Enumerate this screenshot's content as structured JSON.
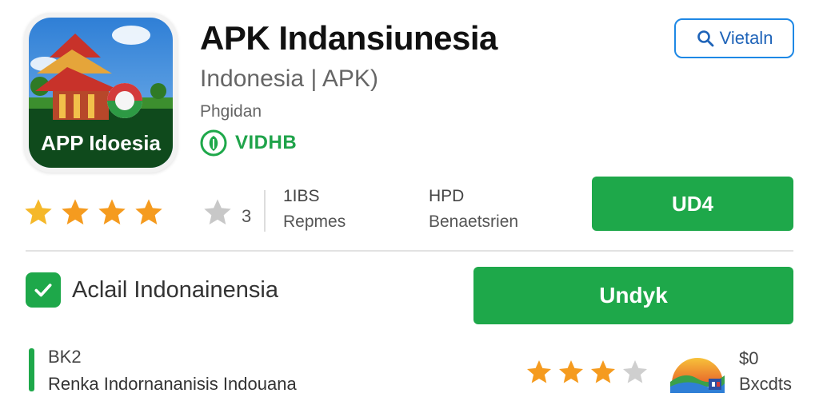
{
  "app": {
    "title": "APK Indansiunesia",
    "subtitle": "Indonesia | APK)",
    "developer": "Phgidan",
    "verified_label": "VIDHB",
    "icon_text": "APP Idoesia"
  },
  "search": {
    "label": "Vietaln"
  },
  "rating": {
    "filled_stars": 4,
    "total_stars": 5,
    "count": "3"
  },
  "stats": [
    {
      "value": "1IBS",
      "label": "Repmes"
    },
    {
      "value": "HPD",
      "label": "Benaetsrien"
    }
  ],
  "buttons": {
    "update": "UD4",
    "download": "Undyk"
  },
  "checkbox": {
    "label": "Aclail Indonainensia",
    "checked": true
  },
  "bottom": {
    "title": "BK2",
    "description": "Renka Indornananisis Indouana",
    "small_rating": 3,
    "small_rating_total": 4,
    "price": "$0",
    "price_label": "Bxcdts"
  },
  "colors": {
    "green": "#1ea84a",
    "blue": "#1e88e5",
    "star_orange": "#f59b1f",
    "star_gray": "#c8c8c8"
  }
}
